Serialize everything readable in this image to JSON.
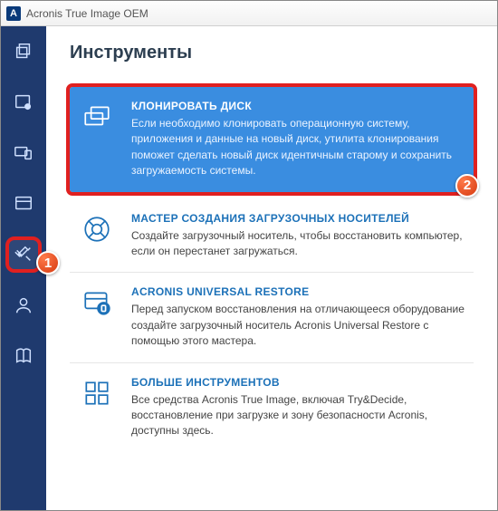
{
  "window": {
    "title": "Acronis True Image OEM"
  },
  "sidebar": {
    "items": [
      {
        "name": "backup"
      },
      {
        "name": "archive"
      },
      {
        "name": "sync"
      },
      {
        "name": "dashboard"
      },
      {
        "name": "tools",
        "highlight_badge": "1"
      },
      {
        "name": "account"
      },
      {
        "name": "help"
      }
    ]
  },
  "page": {
    "heading": "Инструменты",
    "items": [
      {
        "key": "clone",
        "title": "КЛОНИРОВАТЬ ДИСК",
        "desc": "Если необходимо клонировать операционную систему, приложения и данные на новый диск, утилита клонирования поможет сделать новый диск идентичным старому и сохранить загружаемость системы.",
        "primary": true,
        "highlight_badge": "2"
      },
      {
        "key": "rescue",
        "title": "МАСТЕР СОЗДАНИЯ ЗАГРУЗОЧНЫХ НОСИТЕЛЕЙ",
        "desc": "Создайте загрузочный носитель, чтобы восстановить компьютер, если он перестанет загружаться."
      },
      {
        "key": "aur",
        "title": "ACRONIS UNIVERSAL RESTORE",
        "desc": "Перед запуском восстановления на отличающееся оборудование создайте загрузочный носитель Acronis Universal Restore с помощью этого мастера."
      },
      {
        "key": "more",
        "title": "БОЛЬШЕ ИНСТРУМЕНТОВ",
        "desc": "Все средства Acronis True Image, включая Try&Decide, восстановление при загрузке и зону безопасности Acronis, доступны здесь."
      }
    ]
  }
}
